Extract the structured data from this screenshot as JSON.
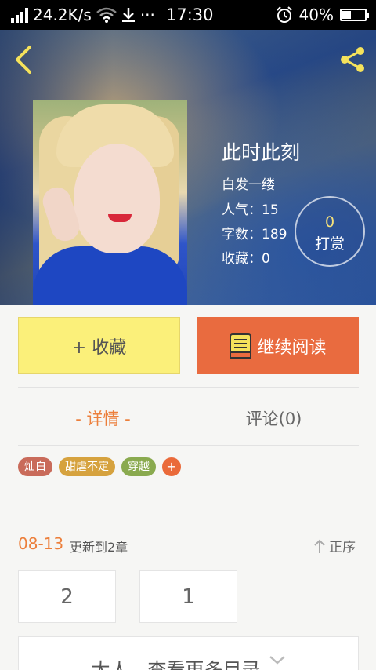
{
  "status_bar": {
    "net_speed": "24.2K/s",
    "more": "···",
    "time": "17:30",
    "battery": "40%",
    "battery_level": 0.4
  },
  "header": {
    "back_icon": "chevron-left-icon",
    "share_icon": "share-icon"
  },
  "book": {
    "title": "此时此刻",
    "author": "白发一缕",
    "popularity": "人气：15",
    "word_count": "字数：189",
    "favorites": "收藏：0",
    "tip_count": "0",
    "tip_label": "打赏"
  },
  "actions": {
    "favorite_label": "+ 收藏",
    "read_label": "继续阅读",
    "read_icon": "book-icon"
  },
  "tabs": [
    {
      "label": "- 详情 -",
      "active": true
    },
    {
      "label": "评论(0)",
      "active": false
    }
  ],
  "tags": [
    {
      "label": "灿白",
      "color": "#c96b5a"
    },
    {
      "label": "甜虐不定",
      "color": "#d6a23e"
    },
    {
      "label": "穿越",
      "color": "#8aaa4f"
    }
  ],
  "tag_add": "+",
  "update": {
    "date": "08-13",
    "text": "更新到2章",
    "sort_label": "正序",
    "sort_icon": "arrow-up-icon"
  },
  "chapters": [
    "2",
    "1"
  ],
  "more_catalog": {
    "label": "大人，查看更多目录",
    "icon": "chevron-down-icon"
  },
  "colors": {
    "accent": "#ec7f3b",
    "read_button": "#e96b3f",
    "favorite_button": "#fbf07a",
    "icon_yellow": "#f5e25b"
  }
}
